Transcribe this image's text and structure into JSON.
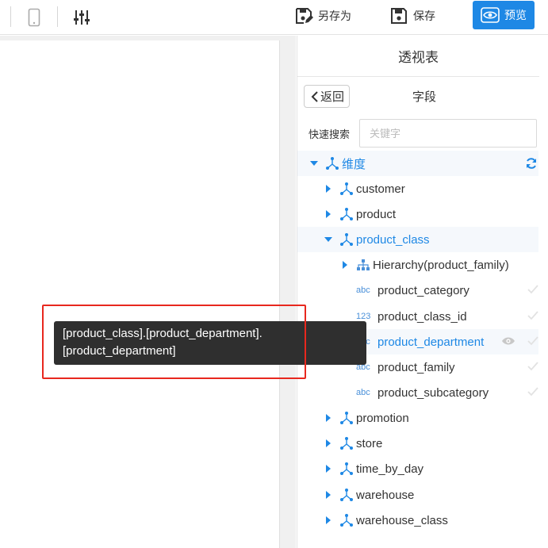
{
  "toolbar": {
    "save_as_label": "另存为",
    "save_label": "保存",
    "preview_label": "预览"
  },
  "panel": {
    "title": "透视表",
    "back_label": "返回",
    "fields_title": "字段",
    "search_label": "快速搜索",
    "search_placeholder": "关键字"
  },
  "tree": {
    "root_label": "维度",
    "dimensions": [
      "customer",
      "product"
    ],
    "expanded": "product_class",
    "hierarchy": "Hierarchy(product_family)",
    "fields": [
      {
        "type": "abc",
        "name": "product_category"
      },
      {
        "type": "123",
        "name": "product_class_id"
      },
      {
        "type": "abc",
        "name": "product_department"
      },
      {
        "type": "abc",
        "name": "product_family"
      },
      {
        "type": "abc",
        "name": "product_subcategory"
      }
    ],
    "more_dimensions": [
      "promotion",
      "store",
      "time_by_day",
      "warehouse",
      "warehouse_class"
    ]
  },
  "tooltip": {
    "line1": "[product_class].[product_department].",
    "line2": "[product_department]"
  },
  "colors": {
    "accent": "#1e88e5",
    "highlight": "#e8281e",
    "tooltip_bg": "#2f2f2f"
  }
}
